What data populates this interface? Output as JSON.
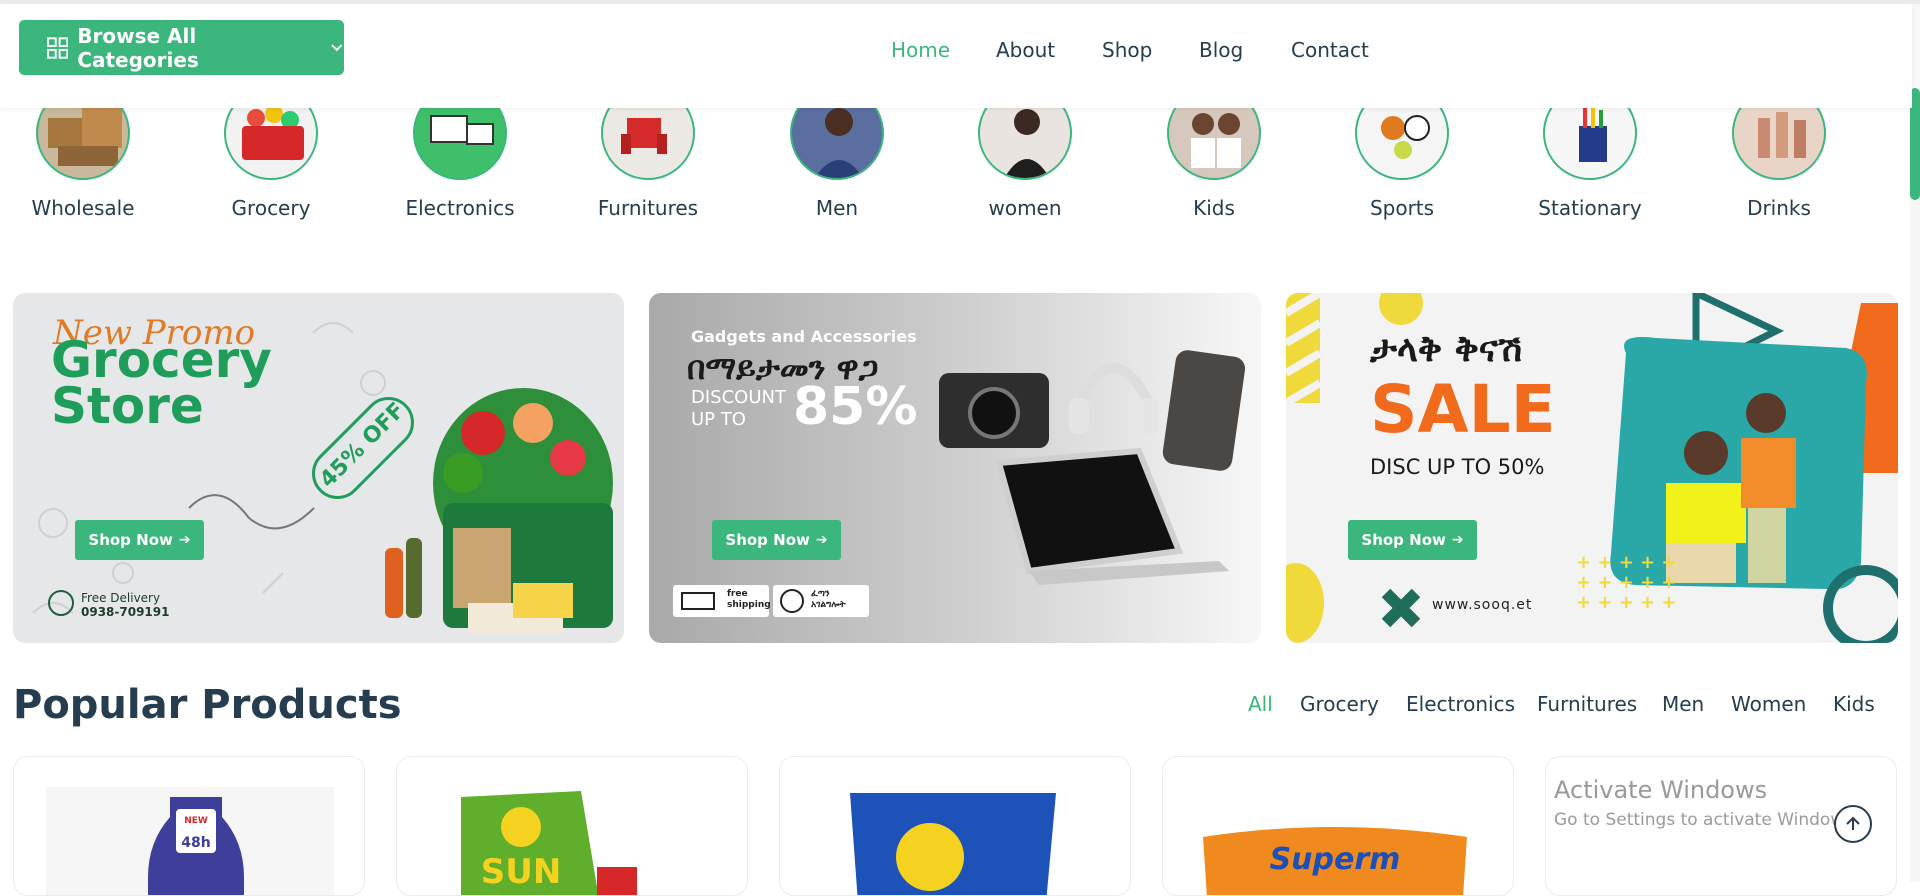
{
  "header": {
    "browse_label": "Browse All Categories",
    "nav": [
      {
        "label": "Home",
        "active": true
      },
      {
        "label": "About",
        "active": false
      },
      {
        "label": "Shop",
        "active": false
      },
      {
        "label": "Blog",
        "active": false
      },
      {
        "label": "Contact",
        "active": false
      }
    ]
  },
  "categories": [
    "Wholesale",
    "Grocery",
    "Electronics",
    "Furnitures",
    "Men",
    "women",
    "Kids",
    "Sports",
    "Stationary",
    "Drinks"
  ],
  "banners": {
    "grocery": {
      "script": "New Promo",
      "title_line1": "Grocery",
      "title_line2": "Store",
      "badge": "45% OFF",
      "cta": "Shop Now",
      "delivery_label": "Free Delivery",
      "delivery_phone": "0938-709191"
    },
    "gadgets": {
      "kicker": "Gadgets and Accessories",
      "amharic": "በማይታመን ዋጋ",
      "discount_line1": "DISCOUNT",
      "discount_line2": "UP TO",
      "percent": "85%",
      "cta": "Shop Now",
      "shipping_line1": "free",
      "shipping_line2": "shipping",
      "time_line1": "ፈጣን",
      "time_line2": "አገልግሎት"
    },
    "sale": {
      "amharic": "ታላቅ ቅናሽ",
      "sale": "SALE",
      "disc": "DISC UP TO 50%",
      "cta": "Shop Now",
      "url": "www.sooq.et"
    }
  },
  "popular": {
    "title": "Popular Products",
    "filters": [
      {
        "label": "All",
        "active": true
      },
      {
        "label": "Grocery",
        "active": false
      },
      {
        "label": "Electronics",
        "active": false
      },
      {
        "label": "Furnitures",
        "active": false
      },
      {
        "label": "Men",
        "active": false
      },
      {
        "label": "Women",
        "active": false
      },
      {
        "label": "Kids",
        "active": false
      }
    ],
    "product_labels": [
      "NEW NOUVEAU 48h",
      "SUN",
      "",
      "Superm"
    ]
  },
  "overlay": {
    "activate_title": "Activate Windows",
    "activate_sub": "Go to Settings to activate Windows."
  },
  "colors": {
    "accent": "#3bb77e",
    "text": "#253d4e",
    "sale_orange": "#f26b1d"
  }
}
